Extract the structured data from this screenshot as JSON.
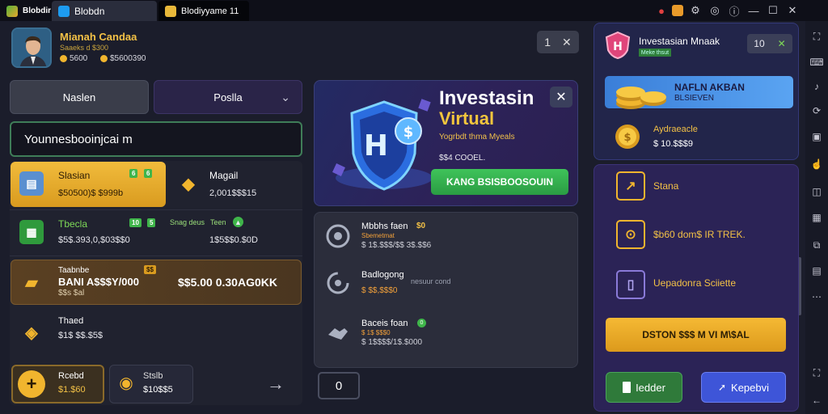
{
  "titlebar": {
    "tabs": [
      {
        "label": "Blobdir",
        "icon": "app-logo-icon"
      },
      {
        "label": "Blobdn",
        "icon": "twitter-bird-icon"
      },
      {
        "label": "Blodiyyame 11",
        "icon": "game-icon"
      }
    ],
    "controls": [
      "alert-icon",
      "notification-icon",
      "settings-icon",
      "help-icon",
      "minimize-icon",
      "maximize-icon",
      "close-icon"
    ]
  },
  "profile": {
    "name": "Mianah Candaa",
    "subtitle": "Saaeks d $300",
    "stat_1": "5600",
    "stat_2": "$5600390"
  },
  "top_pill": {
    "value": "1",
    "close": "✕"
  },
  "tabs": {
    "left": "Naslen",
    "right": "Poslla"
  },
  "search": {
    "value": "Younnesbooinjcai m"
  },
  "left_list": [
    {
      "label": "Slasian",
      "value": "$50500)$ $999b",
      "tag1": "6",
      "tag2": "6"
    },
    {
      "label": "Magail",
      "value": "2,001$$$15"
    },
    {
      "label": "Tbecla",
      "value": "$5$.393,0,$03$$0",
      "tag1": "10",
      "tag2": "5",
      "tag_text": "Snag deus",
      "tag_text2": "Teen",
      "right_value": "1$5$$0.$0D"
    },
    {
      "label": "Taabnbe",
      "value_main": "BANI A$$$Y/000",
      "value_sub": "$$s $al",
      "tag1": "$$",
      "right_value": "$$5.00 0.30AG0KK"
    },
    {
      "label": "Thaed",
      "value": "$1$ $$.$5$"
    }
  ],
  "bottom_cards": [
    {
      "label": "Rcebd",
      "value": "$1.$60"
    },
    {
      "label": "Stslb",
      "value": "$10$$5"
    }
  ],
  "hero": {
    "title": "Investasin",
    "subtitle": "Virtual",
    "line1": "Yogrbdt thma Myeals",
    "line2": "$$4 COOEL.",
    "cta": "KANG BSISBOOSOUIN",
    "close": "✕"
  },
  "mid_list": [
    {
      "label": "Mbbhs faen",
      "badge": "$0",
      "sub": "Sbemetmat",
      "value": "$ 1$.$$$/$$ 3$.$$6"
    },
    {
      "label": "Badlogong",
      "sub": "$ $$,$$$0",
      "extra": "nesuur cond"
    },
    {
      "label": "Baceis foan",
      "badge": "0",
      "sub": "$ 1$ $$$0",
      "value": "$ 1$$$$/1$.$000"
    }
  ],
  "mid_small_button": "0",
  "right_panel": {
    "title": "Investasian Mnaak",
    "subtitle": "Meke thsut",
    "counter": "10",
    "banner_line1": "NAFLN AKBAN",
    "banner_line2": "BLSIEVEN",
    "coins_label": "Aydraeacle",
    "coins_value": "$ 10.$$$9",
    "items": [
      {
        "label": "Stana",
        "icon": "chart-icon"
      },
      {
        "label": "$b60 dom$ IR TREK.",
        "icon": "location-pin-icon"
      },
      {
        "label": "Uepadonra Sciiette",
        "icon": "document-icon"
      }
    ],
    "cta": "DSTON $$$ M VI M\\$AL",
    "btn_left": "Iedder",
    "btn_right": "Kepebvi"
  },
  "colors": {
    "gold": "#f3c146",
    "green": "#3fc35a",
    "blue": "#4a7fe0",
    "accent_purple": "#2b2356"
  }
}
